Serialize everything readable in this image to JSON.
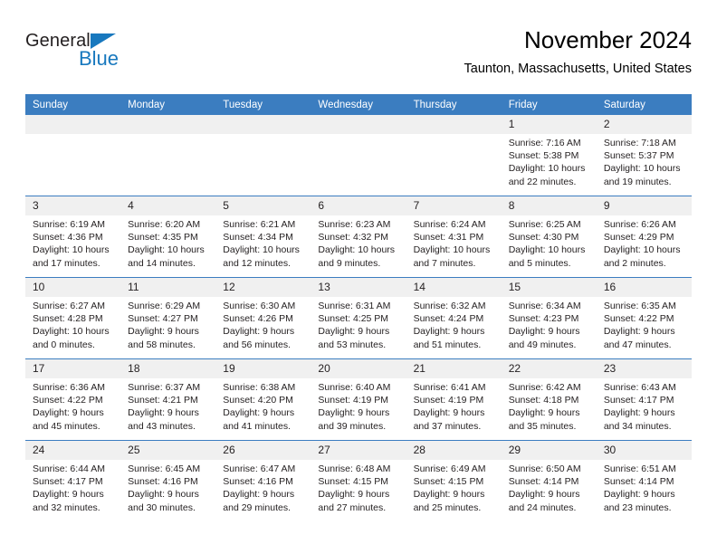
{
  "logo": {
    "word_dark": "General",
    "word_blue": "Blue",
    "triangle_color": "#1878be"
  },
  "header": {
    "month_title": "November 2024",
    "location": "Taunton, Massachusetts, United States"
  },
  "theme": {
    "header_blue": "#3b7dc0",
    "daynum_band": "#f0f0f0",
    "text": "#231f20",
    "logo_blue": "#1878be"
  },
  "weekdays": [
    "Sunday",
    "Monday",
    "Tuesday",
    "Wednesday",
    "Thursday",
    "Friday",
    "Saturday"
  ],
  "labels": {
    "sunrise_prefix": "Sunrise: ",
    "sunset_prefix": "Sunset: ",
    "daylight_prefix": "Daylight: "
  },
  "weeks": [
    [
      {
        "day": "",
        "blank": true
      },
      {
        "day": "",
        "blank": true
      },
      {
        "day": "",
        "blank": true
      },
      {
        "day": "",
        "blank": true
      },
      {
        "day": "",
        "blank": true
      },
      {
        "day": "1",
        "sunrise": "Sunrise: 7:16 AM",
        "sunset": "Sunset: 5:38 PM",
        "daylight": "Daylight: 10 hours and 22 minutes."
      },
      {
        "day": "2",
        "sunrise": "Sunrise: 7:18 AM",
        "sunset": "Sunset: 5:37 PM",
        "daylight": "Daylight: 10 hours and 19 minutes."
      }
    ],
    [
      {
        "day": "3",
        "sunrise": "Sunrise: 6:19 AM",
        "sunset": "Sunset: 4:36 PM",
        "daylight": "Daylight: 10 hours and 17 minutes."
      },
      {
        "day": "4",
        "sunrise": "Sunrise: 6:20 AM",
        "sunset": "Sunset: 4:35 PM",
        "daylight": "Daylight: 10 hours and 14 minutes."
      },
      {
        "day": "5",
        "sunrise": "Sunrise: 6:21 AM",
        "sunset": "Sunset: 4:34 PM",
        "daylight": "Daylight: 10 hours and 12 minutes."
      },
      {
        "day": "6",
        "sunrise": "Sunrise: 6:23 AM",
        "sunset": "Sunset: 4:32 PM",
        "daylight": "Daylight: 10 hours and 9 minutes."
      },
      {
        "day": "7",
        "sunrise": "Sunrise: 6:24 AM",
        "sunset": "Sunset: 4:31 PM",
        "daylight": "Daylight: 10 hours and 7 minutes."
      },
      {
        "day": "8",
        "sunrise": "Sunrise: 6:25 AM",
        "sunset": "Sunset: 4:30 PM",
        "daylight": "Daylight: 10 hours and 5 minutes."
      },
      {
        "day": "9",
        "sunrise": "Sunrise: 6:26 AM",
        "sunset": "Sunset: 4:29 PM",
        "daylight": "Daylight: 10 hours and 2 minutes."
      }
    ],
    [
      {
        "day": "10",
        "sunrise": "Sunrise: 6:27 AM",
        "sunset": "Sunset: 4:28 PM",
        "daylight": "Daylight: 10 hours and 0 minutes."
      },
      {
        "day": "11",
        "sunrise": "Sunrise: 6:29 AM",
        "sunset": "Sunset: 4:27 PM",
        "daylight": "Daylight: 9 hours and 58 minutes."
      },
      {
        "day": "12",
        "sunrise": "Sunrise: 6:30 AM",
        "sunset": "Sunset: 4:26 PM",
        "daylight": "Daylight: 9 hours and 56 minutes."
      },
      {
        "day": "13",
        "sunrise": "Sunrise: 6:31 AM",
        "sunset": "Sunset: 4:25 PM",
        "daylight": "Daylight: 9 hours and 53 minutes."
      },
      {
        "day": "14",
        "sunrise": "Sunrise: 6:32 AM",
        "sunset": "Sunset: 4:24 PM",
        "daylight": "Daylight: 9 hours and 51 minutes."
      },
      {
        "day": "15",
        "sunrise": "Sunrise: 6:34 AM",
        "sunset": "Sunset: 4:23 PM",
        "daylight": "Daylight: 9 hours and 49 minutes."
      },
      {
        "day": "16",
        "sunrise": "Sunrise: 6:35 AM",
        "sunset": "Sunset: 4:22 PM",
        "daylight": "Daylight: 9 hours and 47 minutes."
      }
    ],
    [
      {
        "day": "17",
        "sunrise": "Sunrise: 6:36 AM",
        "sunset": "Sunset: 4:22 PM",
        "daylight": "Daylight: 9 hours and 45 minutes."
      },
      {
        "day": "18",
        "sunrise": "Sunrise: 6:37 AM",
        "sunset": "Sunset: 4:21 PM",
        "daylight": "Daylight: 9 hours and 43 minutes."
      },
      {
        "day": "19",
        "sunrise": "Sunrise: 6:38 AM",
        "sunset": "Sunset: 4:20 PM",
        "daylight": "Daylight: 9 hours and 41 minutes."
      },
      {
        "day": "20",
        "sunrise": "Sunrise: 6:40 AM",
        "sunset": "Sunset: 4:19 PM",
        "daylight": "Daylight: 9 hours and 39 minutes."
      },
      {
        "day": "21",
        "sunrise": "Sunrise: 6:41 AM",
        "sunset": "Sunset: 4:19 PM",
        "daylight": "Daylight: 9 hours and 37 minutes."
      },
      {
        "day": "22",
        "sunrise": "Sunrise: 6:42 AM",
        "sunset": "Sunset: 4:18 PM",
        "daylight": "Daylight: 9 hours and 35 minutes."
      },
      {
        "day": "23",
        "sunrise": "Sunrise: 6:43 AM",
        "sunset": "Sunset: 4:17 PM",
        "daylight": "Daylight: 9 hours and 34 minutes."
      }
    ],
    [
      {
        "day": "24",
        "sunrise": "Sunrise: 6:44 AM",
        "sunset": "Sunset: 4:17 PM",
        "daylight": "Daylight: 9 hours and 32 minutes."
      },
      {
        "day": "25",
        "sunrise": "Sunrise: 6:45 AM",
        "sunset": "Sunset: 4:16 PM",
        "daylight": "Daylight: 9 hours and 30 minutes."
      },
      {
        "day": "26",
        "sunrise": "Sunrise: 6:47 AM",
        "sunset": "Sunset: 4:16 PM",
        "daylight": "Daylight: 9 hours and 29 minutes."
      },
      {
        "day": "27",
        "sunrise": "Sunrise: 6:48 AM",
        "sunset": "Sunset: 4:15 PM",
        "daylight": "Daylight: 9 hours and 27 minutes."
      },
      {
        "day": "28",
        "sunrise": "Sunrise: 6:49 AM",
        "sunset": "Sunset: 4:15 PM",
        "daylight": "Daylight: 9 hours and 25 minutes."
      },
      {
        "day": "29",
        "sunrise": "Sunrise: 6:50 AM",
        "sunset": "Sunset: 4:14 PM",
        "daylight": "Daylight: 9 hours and 24 minutes."
      },
      {
        "day": "30",
        "sunrise": "Sunrise: 6:51 AM",
        "sunset": "Sunset: 4:14 PM",
        "daylight": "Daylight: 9 hours and 23 minutes."
      }
    ]
  ]
}
